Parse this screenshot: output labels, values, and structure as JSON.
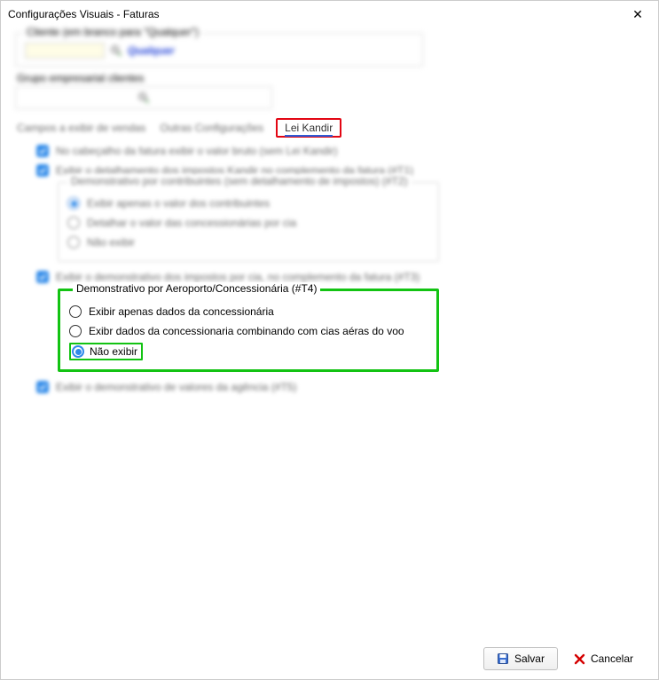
{
  "window": {
    "title": "Configurações Visuais - Faturas"
  },
  "client": {
    "legend": "Cliente (em branco para \"Qualquer\")",
    "value": "",
    "qualquer": "Qualquer"
  },
  "grupo": {
    "label": "Grupo empresarial clientes"
  },
  "tabs": {
    "t1": "Campos a exibir de vendas",
    "t2": "Outras Configurações",
    "t3": "Lei Kandir"
  },
  "opts": {
    "c1": "No cabeçalho da fatura exibir o valor bruto (sem Lei Kandir)",
    "c2": "Exibir o detalhamento dos impostos Kandir no complemento da fatura (#T1)",
    "g1_legend": "Demonstrativo por contribuintes (sem detalhamento de impostos) (#T2)",
    "g1_r1": "Exibir apenas o valor dos contribuintes",
    "g1_r2": "Detalhar o valor das concessionárias por cia",
    "g1_r3": "Não exibir",
    "c3": "Exibir o demonstrativo dos impostos por cia, no complemento da fatura (#T3)",
    "g2_legend": "Demonstrativo por Aeroporto/Concessionária (#T4)",
    "g2_r1": "Exibir apenas dados da concessionária",
    "g2_r2": "Exibr dados da concessionaria combinando com cias aéras do voo",
    "g2_r3": "Não exibir",
    "c4": "Exibir o demonstrativo de valores da agência (#T5)"
  },
  "buttons": {
    "save": "Salvar",
    "cancel": "Cancelar"
  }
}
